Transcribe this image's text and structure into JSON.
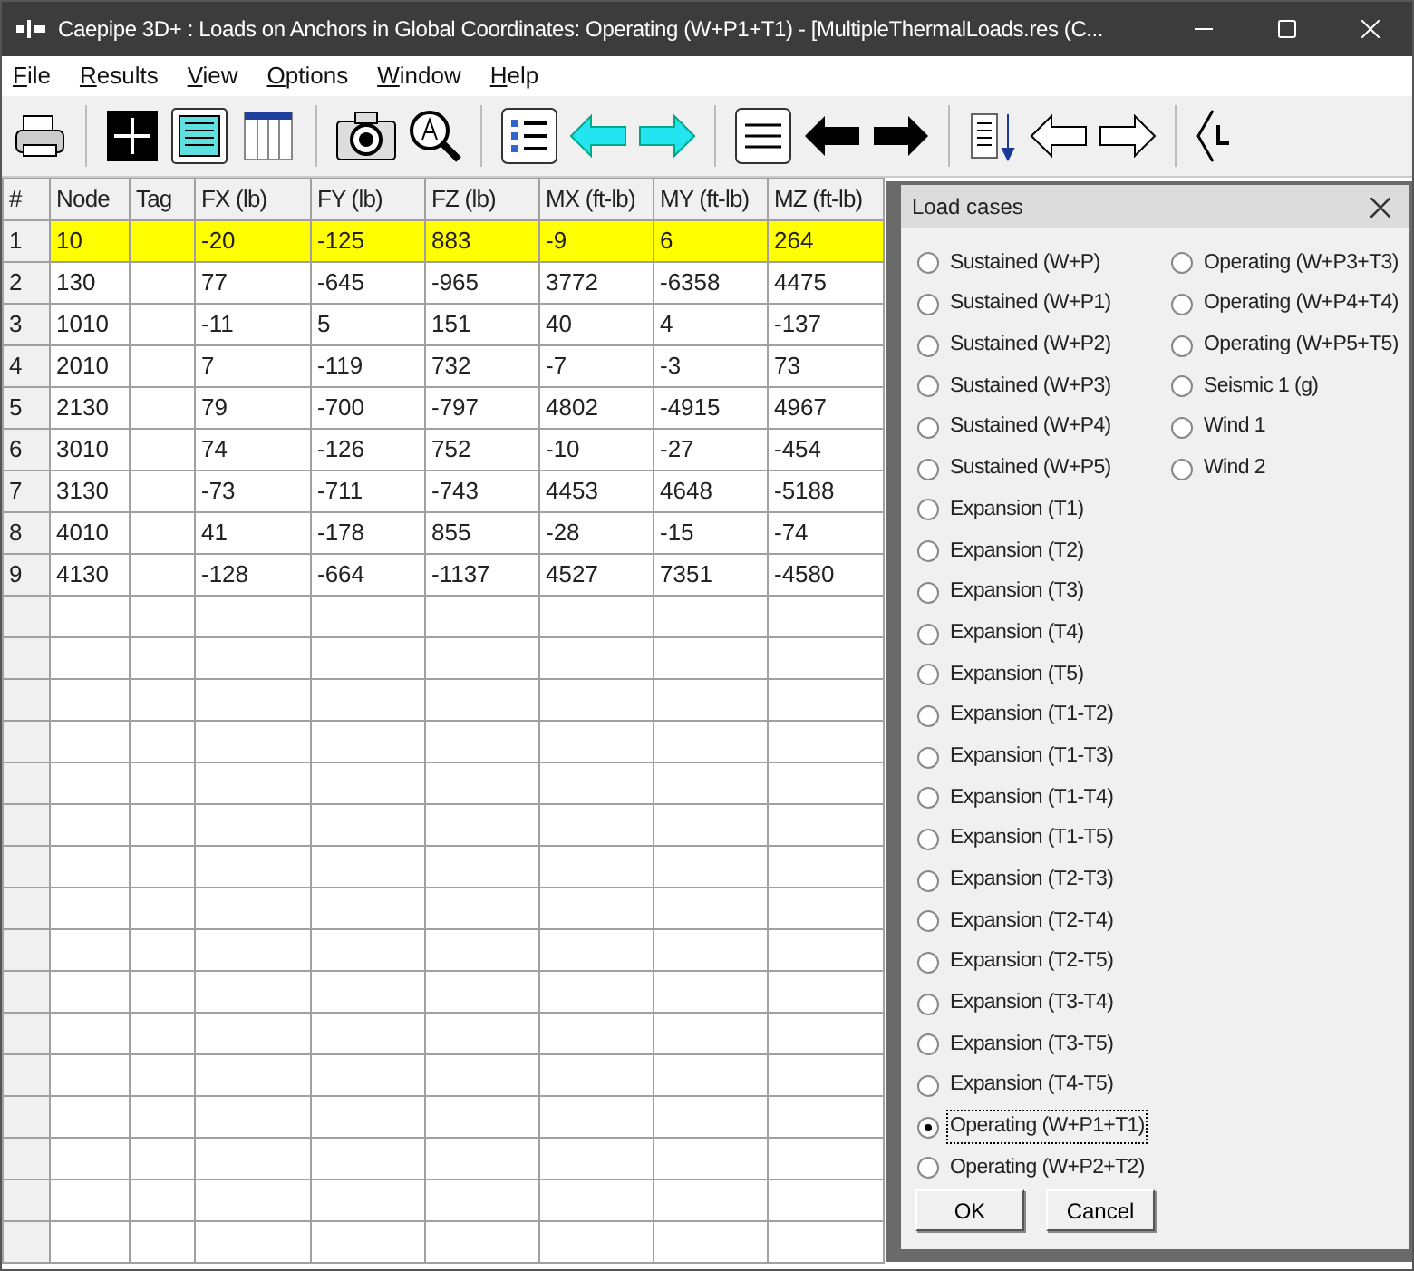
{
  "window": {
    "title": "Caepipe 3D+ : Loads on Anchors in Global Coordinates: Operating (W+P1+T1) -  [MultipleThermalLoads.res (C..."
  },
  "menu": [
    "File",
    "Results",
    "View",
    "Options",
    "Window",
    "Help"
  ],
  "table": {
    "columns": [
      "#",
      "Node",
      "Tag",
      "FX (lb)",
      "FY (lb)",
      "FZ (lb)",
      "MX (ft-lb)",
      "MY (ft-lb)",
      "MZ (ft-lb)"
    ],
    "rows": [
      {
        "selected": true,
        "cells": [
          "1",
          "10",
          "",
          "-20",
          "-125",
          "883",
          "-9",
          "6",
          "264"
        ]
      },
      {
        "selected": false,
        "cells": [
          "2",
          "130",
          "",
          "77",
          "-645",
          "-965",
          "3772",
          "-6358",
          "4475"
        ]
      },
      {
        "selected": false,
        "cells": [
          "3",
          "1010",
          "",
          "-11",
          "5",
          "151",
          "40",
          "4",
          "-137"
        ]
      },
      {
        "selected": false,
        "cells": [
          "4",
          "2010",
          "",
          "7",
          "-119",
          "732",
          "-7",
          "-3",
          "73"
        ]
      },
      {
        "selected": false,
        "cells": [
          "5",
          "2130",
          "",
          "79",
          "-700",
          "-797",
          "4802",
          "-4915",
          "4967"
        ]
      },
      {
        "selected": false,
        "cells": [
          "6",
          "3010",
          "",
          "74",
          "-126",
          "752",
          "-10",
          "-27",
          "-454"
        ]
      },
      {
        "selected": false,
        "cells": [
          "7",
          "3130",
          "",
          "-73",
          "-711",
          "-743",
          "4453",
          "4648",
          "-5188"
        ]
      },
      {
        "selected": false,
        "cells": [
          "8",
          "4010",
          "",
          "41",
          "-178",
          "855",
          "-28",
          "-15",
          "-74"
        ]
      },
      {
        "selected": false,
        "cells": [
          "9",
          "4130",
          "",
          "-128",
          "-664",
          "-1137",
          "4527",
          "7351",
          "-4580"
        ]
      }
    ]
  },
  "dialog": {
    "title": "Load cases",
    "options": [
      {
        "label": "Sustained (W+P)",
        "selected": false
      },
      {
        "label": "Sustained (W+P1)",
        "selected": false
      },
      {
        "label": "Sustained (W+P2)",
        "selected": false
      },
      {
        "label": "Sustained (W+P3)",
        "selected": false
      },
      {
        "label": "Sustained (W+P4)",
        "selected": false
      },
      {
        "label": "Sustained (W+P5)",
        "selected": false
      },
      {
        "label": "Expansion (T1)",
        "selected": false
      },
      {
        "label": "Expansion (T2)",
        "selected": false
      },
      {
        "label": "Expansion (T3)",
        "selected": false
      },
      {
        "label": "Expansion (T4)",
        "selected": false
      },
      {
        "label": "Expansion (T5)",
        "selected": false
      },
      {
        "label": "Expansion (T1-T2)",
        "selected": false
      },
      {
        "label": "Expansion (T1-T3)",
        "selected": false
      },
      {
        "label": "Expansion (T1-T4)",
        "selected": false
      },
      {
        "label": "Expansion (T1-T5)",
        "selected": false
      },
      {
        "label": "Expansion (T2-T3)",
        "selected": false
      },
      {
        "label": "Expansion (T2-T4)",
        "selected": false
      },
      {
        "label": "Expansion (T2-T5)",
        "selected": false
      },
      {
        "label": "Expansion (T3-T4)",
        "selected": false
      },
      {
        "label": "Expansion (T3-T5)",
        "selected": false
      },
      {
        "label": "Expansion (T4-T5)",
        "selected": false
      },
      {
        "label": "Operating (W+P1+T1)",
        "selected": true
      },
      {
        "label": "Operating (W+P2+T2)",
        "selected": false
      },
      {
        "label": "Operating (W+P3+T3)",
        "selected": false
      },
      {
        "label": "Operating (W+P4+T4)",
        "selected": false
      },
      {
        "label": "Operating (W+P5+T5)",
        "selected": false
      },
      {
        "label": "Seismic 1 (g)",
        "selected": false
      },
      {
        "label": "Wind 1",
        "selected": false
      },
      {
        "label": "Wind 2",
        "selected": false
      }
    ],
    "buttons": [
      "OK",
      "Cancel"
    ]
  }
}
